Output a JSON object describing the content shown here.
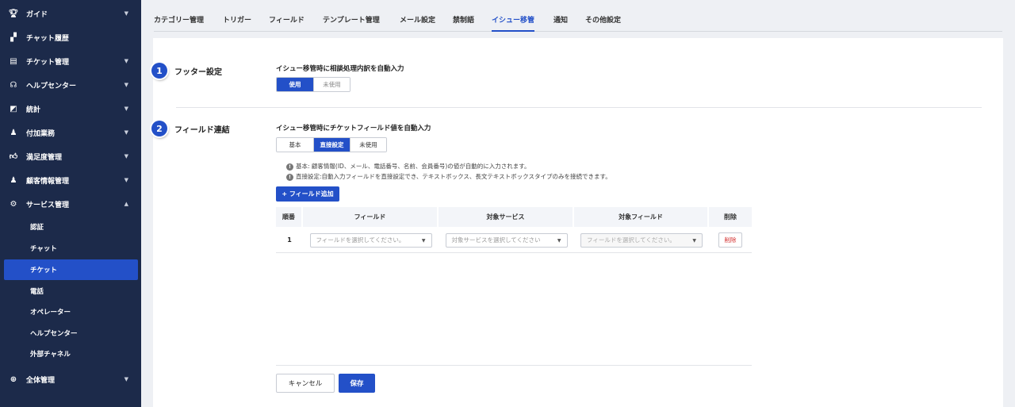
{
  "sidebar": {
    "items": [
      {
        "label": "ガイド",
        "icon": "trophy-icon",
        "chevron": "▼"
      },
      {
        "label": "チャット履歴",
        "icon": "chat-bubbles-icon",
        "chevron": ""
      },
      {
        "label": "チケット管理",
        "icon": "document-icon",
        "chevron": "▼"
      },
      {
        "label": "ヘルプセンター",
        "icon": "support-icon",
        "chevron": "▼"
      },
      {
        "label": "統計",
        "icon": "chart-icon",
        "chevron": "▼"
      },
      {
        "label": "付加業務",
        "icon": "user-extra-icon",
        "chevron": "▼"
      },
      {
        "label": "満足度管理",
        "icon": "thumbs-up-icon",
        "chevron": "▼"
      },
      {
        "label": "顧客情報管理",
        "icon": "customer-icon",
        "chevron": "▼"
      },
      {
        "label": "サービス管理",
        "icon": "gear-icon",
        "chevron": "▲"
      }
    ],
    "sub_items": [
      "認証",
      "チャット",
      "チケット",
      "電話",
      "オペレーター",
      "ヘルプセンター",
      "外部チャネル"
    ],
    "footer_item": {
      "label": "全体管理",
      "icon": "plus-circle-icon",
      "chevron": "▼"
    }
  },
  "tabs": [
    "カテゴリー管理",
    "トリガー",
    "フィールド",
    "テンプレート管理",
    "メール設定",
    "禁制語",
    "イシュー移管",
    "通知",
    "その他設定"
  ],
  "footer_section": {
    "number": "1",
    "title": "フッター設定",
    "subtitle": "イシュー移管時に相談処理内訳を自動入力",
    "options": [
      "使用",
      "未使用"
    ]
  },
  "field_section": {
    "number": "2",
    "title": "フィールド連結",
    "subtitle": "イシュー移管時にチケットフィールド値を自動入力",
    "options": [
      "基本",
      "直接設定",
      "未使用"
    ],
    "notes": [
      "基本: 顧客情報(ID、メール、電話番号、名前、会員番号)の値が自動的に入力されます。",
      "直接設定:自動入力フィールドを直接設定でき、テキストボックス、長文テキストボックスタイプのみを接続できます。"
    ],
    "add_button": "+ フィールド追加",
    "table": {
      "headers": [
        "順番",
        "フィールド",
        "対象サービス",
        "対象フィールド",
        "削除"
      ],
      "row": {
        "order": "1",
        "field_placeholder": "フィールドを選択してください。",
        "service_placeholder": "対象サービスを選択してください",
        "target_placeholder": "フィールドを選択してください。",
        "delete_label": "削除"
      }
    }
  },
  "actions": {
    "cancel": "キャンセル",
    "save": "保存"
  },
  "colors": {
    "sidebar": "#1c2a4a",
    "accent": "#2350c8",
    "danger": "#d32f2f"
  }
}
